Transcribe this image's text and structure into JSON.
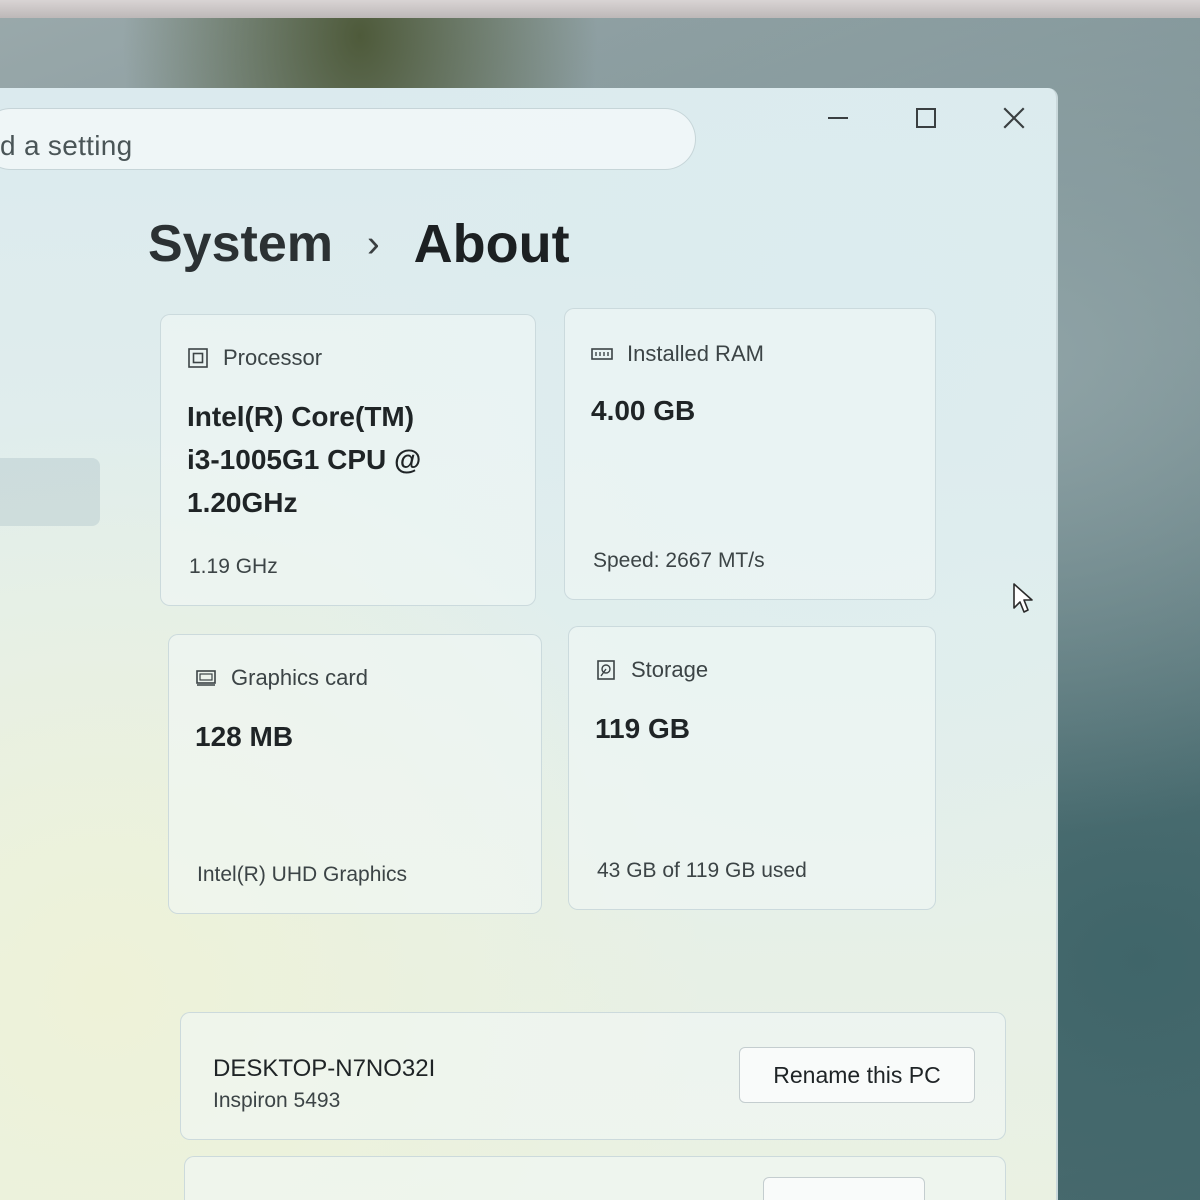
{
  "window": {
    "search_placeholder": "d a setting",
    "controls": {
      "minimize_icon": "minimize-icon",
      "maximize_icon": "maximize-icon",
      "close_icon": "close-icon"
    }
  },
  "breadcrumb": {
    "parent": "System",
    "separator": "›",
    "current": "About"
  },
  "specs": {
    "processor": {
      "label": "Processor",
      "value_lines": [
        "Intel(R) Core(TM)",
        "i3-1005G1 CPU @",
        "1.20GHz"
      ],
      "sub": "1.19 GHz",
      "icon": "processor-icon"
    },
    "ram": {
      "label": "Installed RAM",
      "value": "4.00 GB",
      "sub": "Speed: 2667 MT/s",
      "icon": "ram-icon"
    },
    "graphics": {
      "label": "Graphics card",
      "value": "128 MB",
      "sub": "Intel(R) UHD Graphics",
      "icon": "graphics-card-icon"
    },
    "storage": {
      "label": "Storage",
      "value": "119 GB",
      "sub": "43 GB of 119 GB used",
      "icon": "storage-icon"
    }
  },
  "device": {
    "name": "DESKTOP-N7NO32I",
    "model": "Inspiron 5493",
    "rename_label": "Rename this PC"
  }
}
